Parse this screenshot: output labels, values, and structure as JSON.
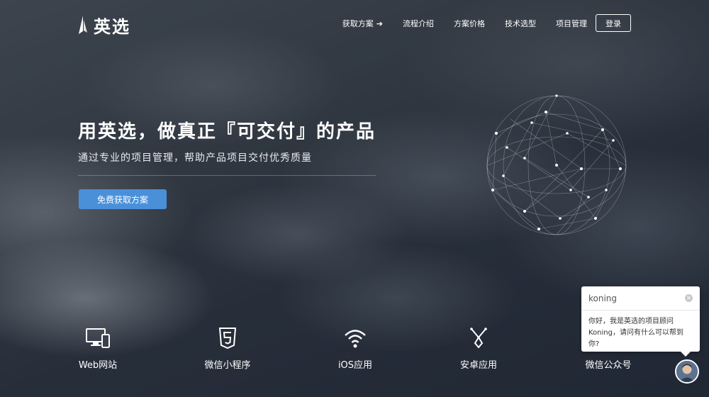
{
  "brand": {
    "name": "英选"
  },
  "nav": {
    "items": [
      {
        "label": "获取方案",
        "icon": "arrow-right-icon"
      },
      {
        "label": "流程介绍"
      },
      {
        "label": "方案价格"
      },
      {
        "label": "技术选型"
      },
      {
        "label": "项目管理"
      }
    ],
    "login_label": "登录"
  },
  "hero": {
    "title": "用英选，做真正『可交付』的产品",
    "subtitle": "通过专业的项目管理，帮助产品项目交付优秀质量",
    "cta_label": "免费获取方案"
  },
  "services": [
    {
      "label": "Web网站",
      "icon": "desktop-mobile-icon"
    },
    {
      "label": "微信小程序",
      "icon": "html5-icon"
    },
    {
      "label": "iOS应用",
      "icon": "wifi-icon"
    },
    {
      "label": "安卓应用",
      "icon": "android-icon"
    },
    {
      "label": "微信公众号",
      "icon": "wechat-icon"
    }
  ],
  "chat": {
    "name": "koning",
    "message": "你好，我是英选的项目顾问Koning，请问有什么可以帮到你?"
  },
  "colors": {
    "accent": "#4a90d9"
  }
}
